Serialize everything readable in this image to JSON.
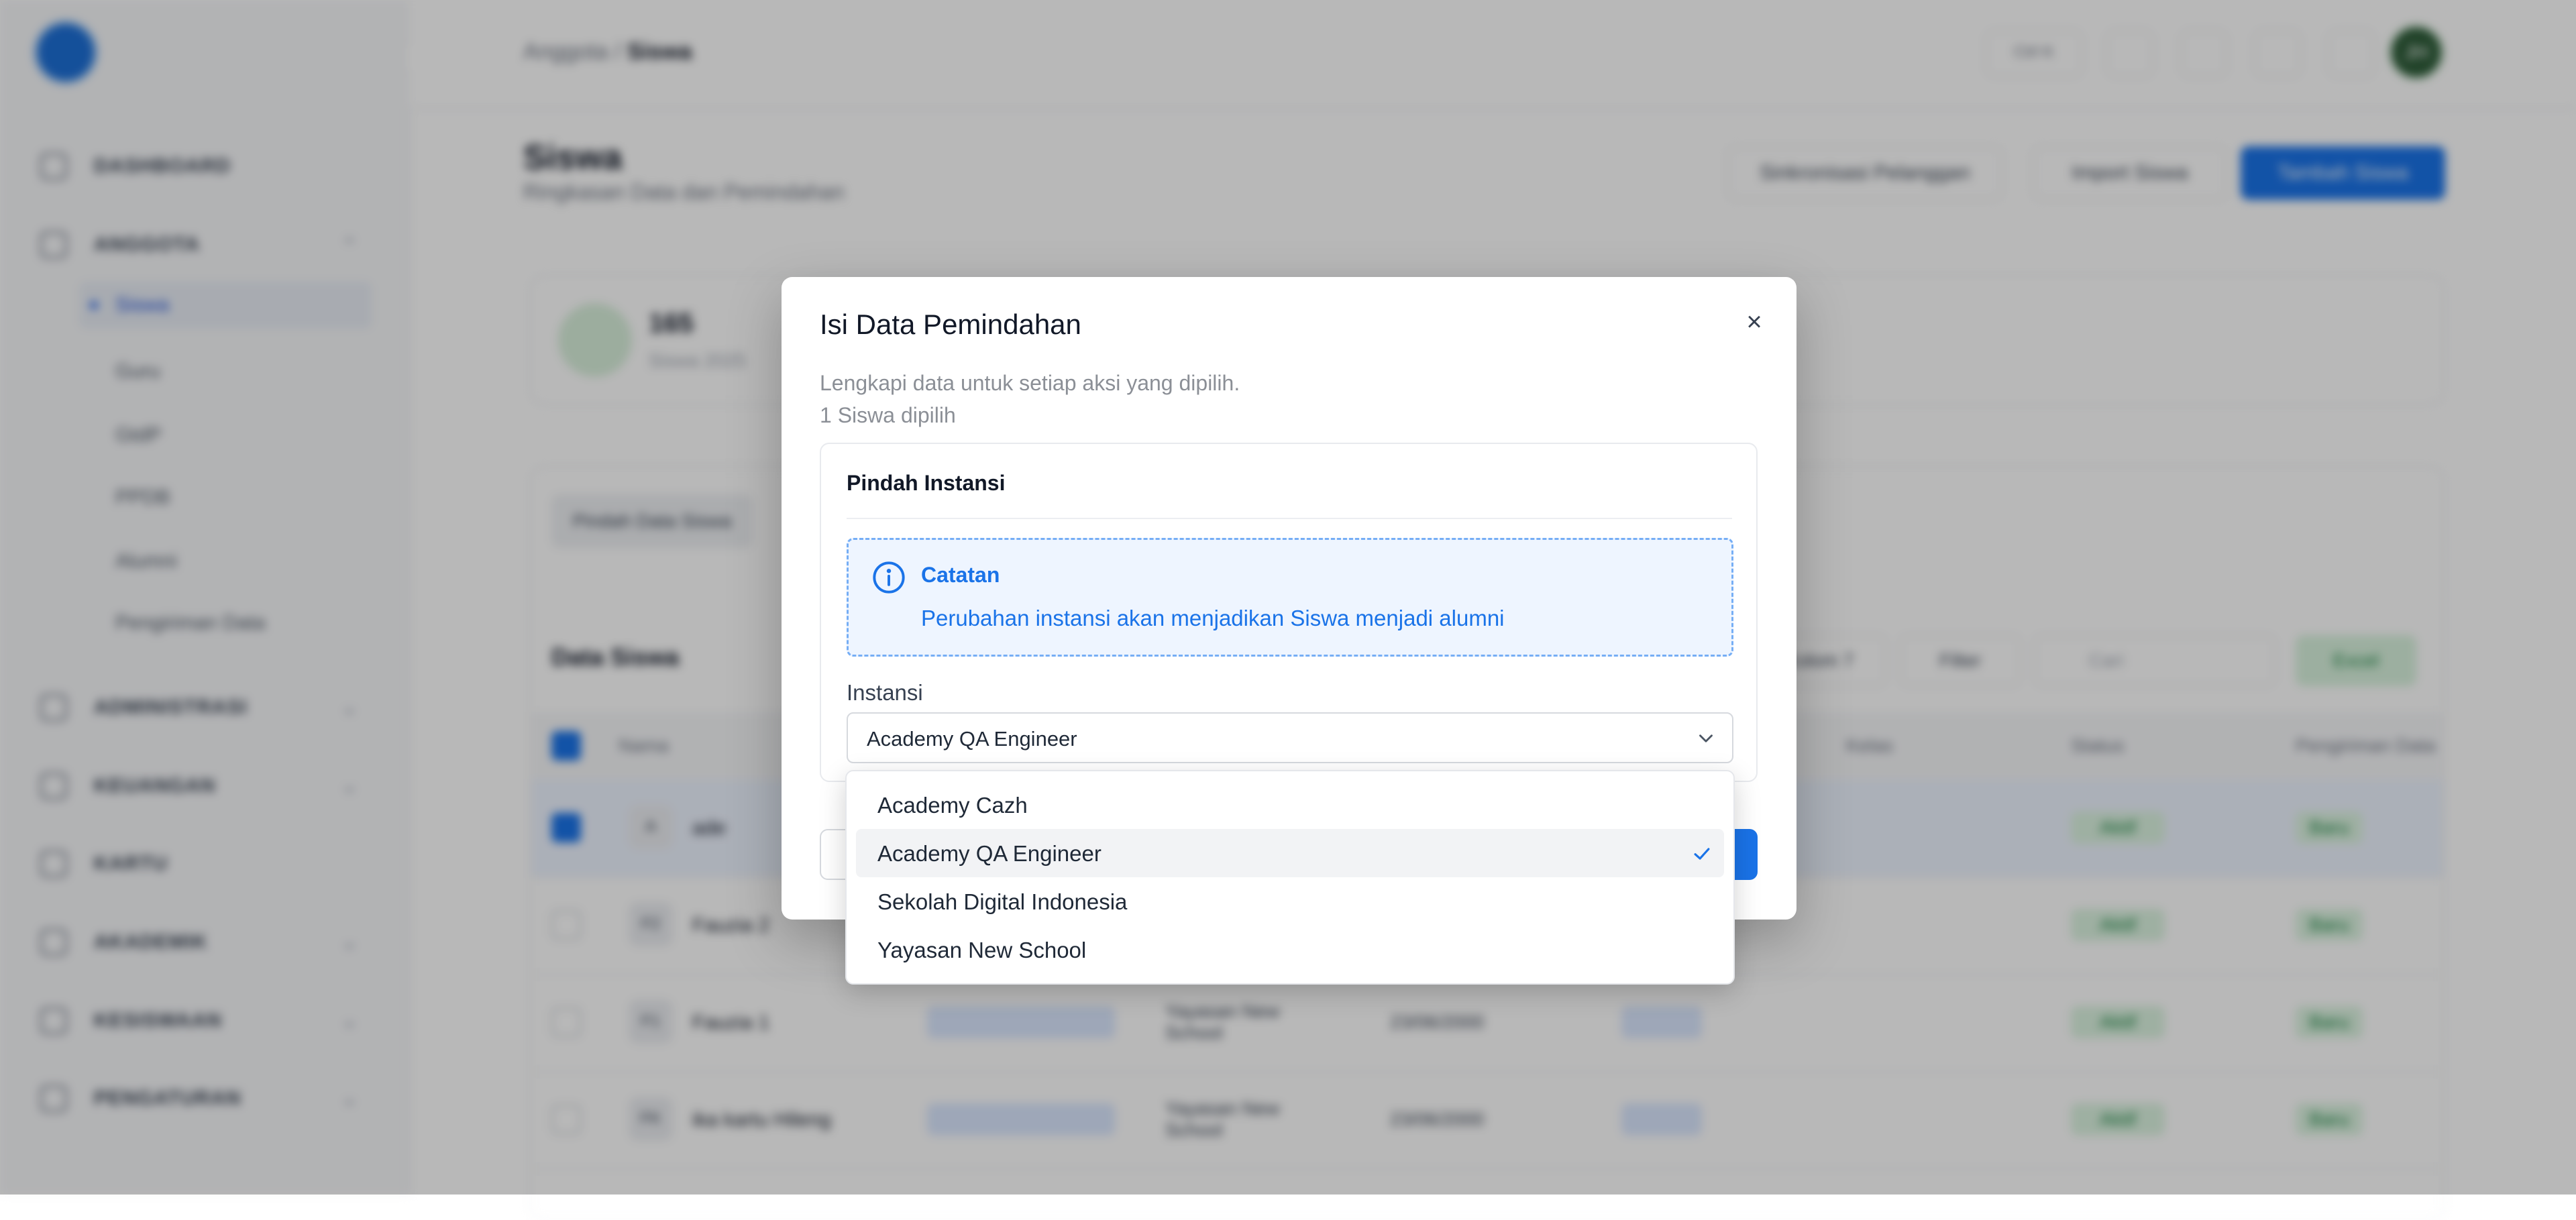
{
  "sidebar": {
    "items": [
      {
        "label": "DASHBOARD"
      },
      {
        "label": "ANGGOTA"
      },
      {
        "label": "ADMINISTRASI"
      },
      {
        "label": "KEUANGAN"
      },
      {
        "label": "KARTU"
      },
      {
        "label": "AKADEMIK"
      },
      {
        "label": "KESISWAAN"
      },
      {
        "label": "PENGATURAN"
      }
    ],
    "subitems": [
      "Siswa",
      "Guru",
      "GtdP",
      "PPDB",
      "Alumni",
      "Pengiriman Data"
    ]
  },
  "topbar": {
    "breadcrumb_parent": "Anggota",
    "breadcrumb_separator": "/",
    "breadcrumb_current": "Siswa",
    "shortcut": "Ctrl K",
    "avatar_initials": "JH"
  },
  "page": {
    "title": "Siswa",
    "subtitle": "Ringkasan Data dan Pemindahan",
    "sync_button": "Sinkronisasi Pelanggan",
    "import_button": "Import Siswa",
    "add_button": "Tambah Siswa"
  },
  "stats": {
    "value": "165",
    "label": "Siswa 2025"
  },
  "table": {
    "tab_label": "Pindah Data Siswa",
    "title": "Data Siswa",
    "kolom_button": "Kolom 7",
    "filter_button": "Filter",
    "search_placeholder": "Cari",
    "excel_button": "Excel",
    "headers": [
      "Nama",
      "Kelas",
      "Status",
      "Pengiriman Data"
    ],
    "rows": [
      {
        "initial": "A",
        "name": "ade",
        "instansi": "",
        "date": ""
      },
      {
        "initial": "F2",
        "name": "Fauzia 2",
        "instansi": "",
        "date": ""
      },
      {
        "initial": "F1",
        "name": "Fauzia 1",
        "instansi": "Yayasan New School",
        "date": "23/06/2000"
      },
      {
        "initial": "FK",
        "name": "ika kartu Hileng",
        "instansi": "Yayasan New School",
        "date": "23/06/2000"
      }
    ],
    "status_label": "Aktif",
    "sent_label": "Baru"
  },
  "modal": {
    "title": "Isi Data Pemindahan",
    "description": "Lengkapi data untuk setiap aksi yang dipilih.",
    "selected_count": "1 Siswa dipilih",
    "section_title": "Pindah Instansi",
    "note_title": "Catatan",
    "note_text": "Perubahan instansi akan menjadikan Siswa menjadi alumni",
    "field_label": "Instansi",
    "selected_value": "Academy QA Engineer"
  },
  "dropdown": {
    "options": [
      {
        "label": "Academy Cazh",
        "selected": false
      },
      {
        "label": "Academy QA Engineer",
        "selected": true
      },
      {
        "label": "Sekolah Digital Indonesia",
        "selected": false
      },
      {
        "label": "Yayasan New School",
        "selected": false
      }
    ]
  },
  "colors": {
    "accent": "#1a73e8",
    "note_bg": "#eef5ff",
    "note_border": "#76aef5",
    "overlay": "rgba(0,0,0,0.28)"
  }
}
